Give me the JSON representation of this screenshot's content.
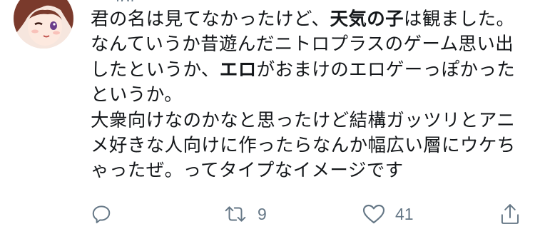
{
  "tweet": {
    "header_clipped": "…",
    "author_handle_clipped": "@",
    "text_lines": [
      [
        {
          "t": "君の名は見てなかったけど、"
        },
        {
          "t": "天気の子",
          "bold": true
        },
        {
          "t": "は観ました。"
        }
      ],
      [
        {
          "t": "なんていうか昔遊んだニトロプラスのゲーム思い出"
        }
      ],
      [
        {
          "t": "したというか、"
        },
        {
          "t": "エロ",
          "bold": true
        },
        {
          "t": "がおまけのエロゲーっぽかった"
        }
      ],
      [
        {
          "t": "というか。"
        }
      ],
      [
        {
          "t": "大衆向けなのかなと思ったけど結構ガッツリとアニ"
        }
      ],
      [
        {
          "t": "メ好きな人向けに作ったらなんか幅広い層にウケち"
        }
      ],
      [
        {
          "t": "ゃったぜ。ってタイプなイメージです"
        }
      ]
    ]
  },
  "actions": {
    "reply": {
      "icon": "reply-icon",
      "count": ""
    },
    "retweet": {
      "icon": "retweet-icon",
      "count": "9"
    },
    "like": {
      "icon": "heart-icon",
      "count": "41"
    },
    "share": {
      "icon": "share-icon",
      "count": ""
    }
  },
  "colors": {
    "text": "#14171a",
    "secondary": "#657786",
    "background": "#ffffff"
  }
}
